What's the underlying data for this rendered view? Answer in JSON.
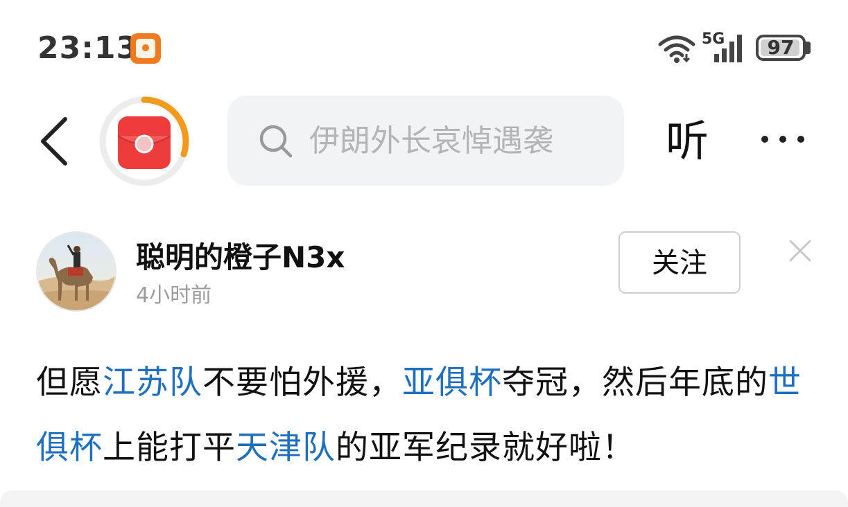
{
  "status_bar": {
    "time": "23:13",
    "network": "5G",
    "battery": "97",
    "battery_level_percent": 97,
    "app_icon": "red-envelope-notification-icon",
    "icons": [
      "wifi-icon",
      "signal-icon",
      "battery-icon"
    ]
  },
  "nav": {
    "back_icon": "chevron-left-icon",
    "red_packet_icon": "red-envelope-icon",
    "red_packet_progress_percent": 30,
    "search": {
      "icon": "search-icon",
      "placeholder": "伊朗外长哀悼遇袭"
    },
    "listen_label": "听",
    "more_icon": "more-dots-icon"
  },
  "author": {
    "name": "聪明的橙子N3x",
    "time": "4小时前",
    "follow_label": "关注",
    "avatar": "avatar-camel-desert",
    "close_icon": "close-icon"
  },
  "post": {
    "segments": [
      {
        "text": "但愿",
        "link": false
      },
      {
        "text": "江苏队",
        "link": true
      },
      {
        "text": "不要怕外援，",
        "link": false
      },
      {
        "text": "亚俱杯",
        "link": true
      },
      {
        "text": "夺冠，然后年底的",
        "link": false
      },
      {
        "text": "世俱杯",
        "link": true
      },
      {
        "text": "上能打平",
        "link": false
      },
      {
        "text": "天津队",
        "link": true
      },
      {
        "text": "的亚军纪录就好啦！",
        "link": false
      }
    ]
  },
  "colors": {
    "link": "#1f6fbf",
    "accent_orange": "#f39a1d",
    "red_packet": "#ee3c3c",
    "search_bg": "#f2f3f5",
    "muted_text": "#9b9b9b"
  }
}
